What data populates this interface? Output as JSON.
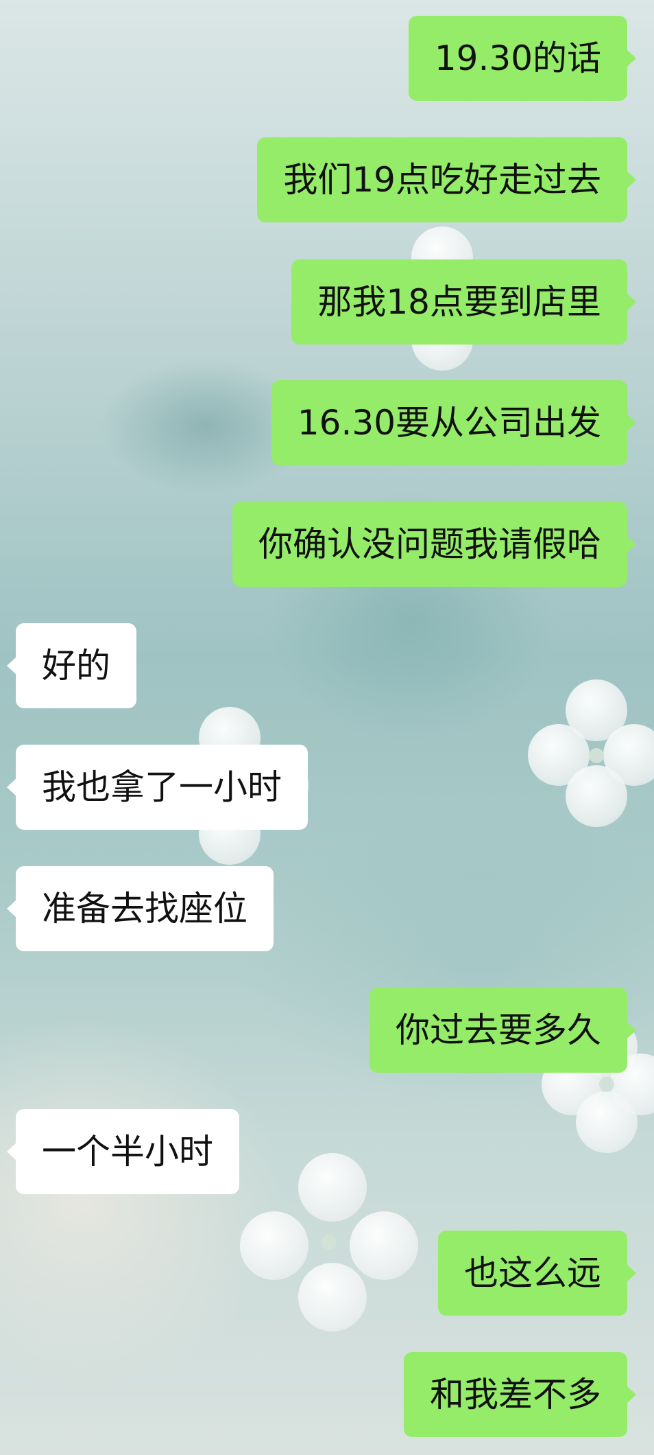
{
  "chat": {
    "messages": [
      {
        "side": "sent",
        "text": "19.30的话"
      },
      {
        "side": "sent",
        "text": "我们19点吃好走过去"
      },
      {
        "side": "sent",
        "text": "那我18点要到店里"
      },
      {
        "side": "sent",
        "text": "16.30要从公司出发"
      },
      {
        "side": "sent",
        "text": "你确认没问题我请假哈"
      },
      {
        "side": "received",
        "text": "好的"
      },
      {
        "side": "received",
        "text": "我也拿了一小时"
      },
      {
        "side": "received",
        "text": "准备去找座位"
      },
      {
        "side": "sent",
        "text": "你过去要多久"
      },
      {
        "side": "received",
        "text": "一个半小时"
      },
      {
        "side": "sent",
        "text": "也这么远"
      },
      {
        "side": "sent",
        "text": "和我差不多"
      }
    ]
  },
  "colors": {
    "sent_bubble": "#95ec69",
    "received_bubble": "#ffffff",
    "text": "#111111"
  }
}
